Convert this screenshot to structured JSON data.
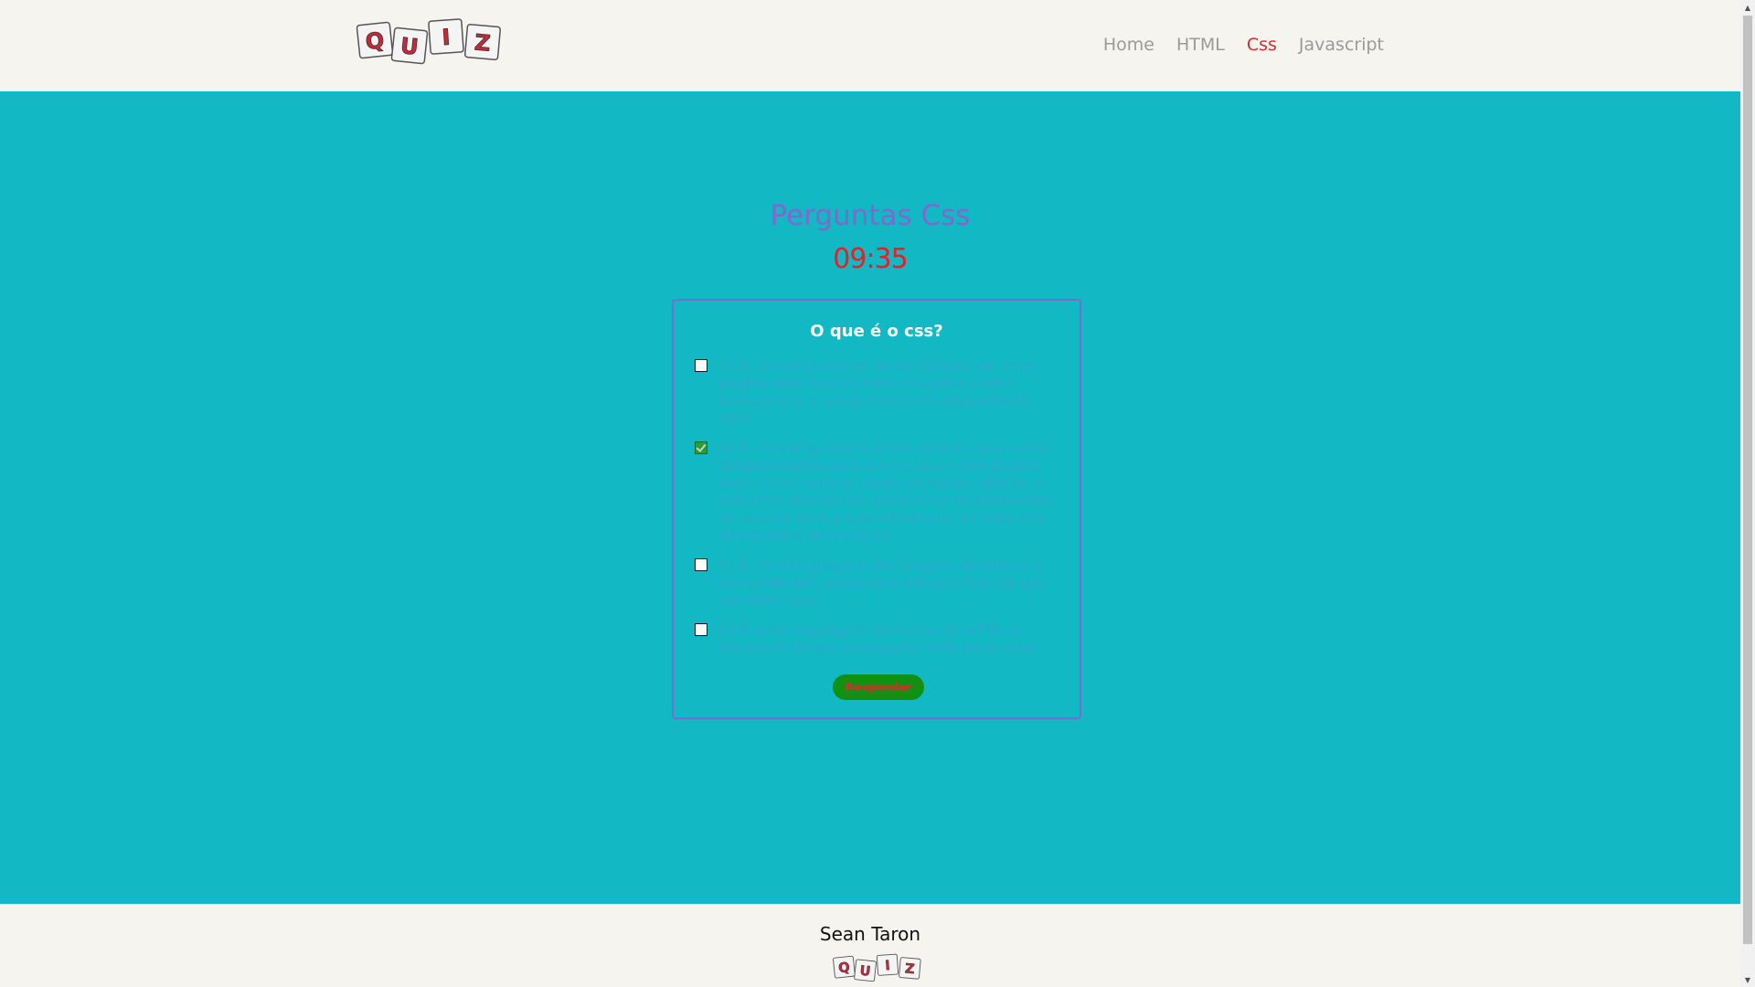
{
  "header": {
    "logo_letters": [
      "Q",
      "U",
      "I",
      "Z"
    ],
    "nav": [
      {
        "label": "Home",
        "active": false
      },
      {
        "label": "HTML",
        "active": false
      },
      {
        "label": "Css",
        "active": true
      },
      {
        "label": "Javascript",
        "active": false
      }
    ]
  },
  "main": {
    "title": "Perguntas Css",
    "timer": "09:35",
    "question": "O que é o css?",
    "options": [
      {
        "label": "A) É uma linguagem de estilização de uma página web que só funciona junto com o javascript e é completamente dependente dele.",
        "checked": false
      },
      {
        "label": "B) É uma linguagem de estilização que serve simplesmente para dar estilos a sua página web, como colocar cores de fundo, alterar o tamanho dos textos, posicionar os elementos de acordo com a sua referência, ou seja, ela dá estilos a uma página",
        "checked": true
      },
      {
        "label": "C) É uma linguagem de tipagem dinâmica e não pode ser usada com eficácia fora de um servidor local.",
        "checked": false
      },
      {
        "label": "D) É uma linguagem derivada do HTML e necessita de um navegador web para rodar",
        "checked": false
      }
    ],
    "answer_button": "Responder"
  },
  "footer": {
    "author": "Sean Taron",
    "logo_letters": [
      "Q",
      "U",
      "I",
      "Z"
    ]
  },
  "colors": {
    "header_bg": "#f5f4ef",
    "main_bg": "#12b8c3",
    "title": "#8466cf",
    "timer": "#ee1d23",
    "nav_active": "#e5262b",
    "nav": "#9a9a9a",
    "option_text": "#2aa9c9",
    "button_bg": "#119012"
  },
  "icons": {
    "logo": "quiz-logo-tiles",
    "checkbox": "checkbox-icon"
  }
}
